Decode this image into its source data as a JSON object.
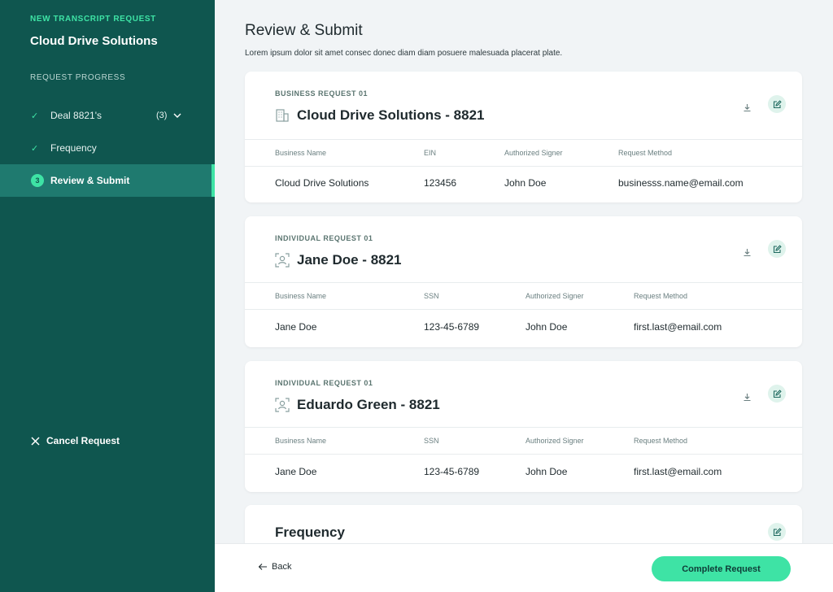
{
  "sidebar": {
    "kicker": "NEW TRANSCRIPT REQUEST",
    "company": "Cloud Drive Solutions",
    "section_label": "REQUEST PROGRESS",
    "steps": [
      {
        "label": "Deal 8821's",
        "count": "(3)",
        "state": "done"
      },
      {
        "label": "Frequency",
        "state": "done"
      },
      {
        "label": "Review & Submit",
        "number": "3",
        "state": "active"
      }
    ],
    "cancel_label": "Cancel Request"
  },
  "main": {
    "title": "Review & Submit",
    "description": "Lorem ipsum dolor sit amet consec donec diam diam posuere malesuada placerat plate.",
    "cards": [
      {
        "kicker": "BUSINESS REQUEST 01",
        "icon": "building-icon",
        "title": "Cloud Drive Solutions - 8821",
        "headers": [
          "Business Name",
          "EIN",
          "Authorized Signer",
          "Request Method"
        ],
        "values": [
          "Cloud Drive Solutions",
          "123456",
          "John Doe",
          "businesss.name@email.com"
        ]
      },
      {
        "kicker": "INDIVIDUAL REQUEST 01",
        "icon": "person-icon",
        "title": "Jane Doe - 8821",
        "headers": [
          "Business Name",
          "SSN",
          "Authorized Signer",
          "Request Method"
        ],
        "values": [
          "Jane Doe",
          "123-45-6789",
          "John Doe",
          "first.last@email.com"
        ]
      },
      {
        "kicker": "INDIVIDUAL REQUEST 01",
        "icon": "person-icon",
        "title": "Eduardo Green - 8821",
        "headers": [
          "Business Name",
          "SSN",
          "Authorized Signer",
          "Request Method"
        ],
        "values": [
          "Jane Doe",
          "123-45-6789",
          "John Doe",
          "first.last@email.com"
        ]
      }
    ],
    "frequency_title": "Frequency"
  },
  "footer": {
    "back_label": "Back",
    "complete_label": "Complete Request"
  },
  "colors": {
    "sidebar_bg": "#0f564f",
    "accent": "#3ee3a5",
    "active_step_bg": "#1f7a6f",
    "main_bg": "#f1f4f6"
  }
}
